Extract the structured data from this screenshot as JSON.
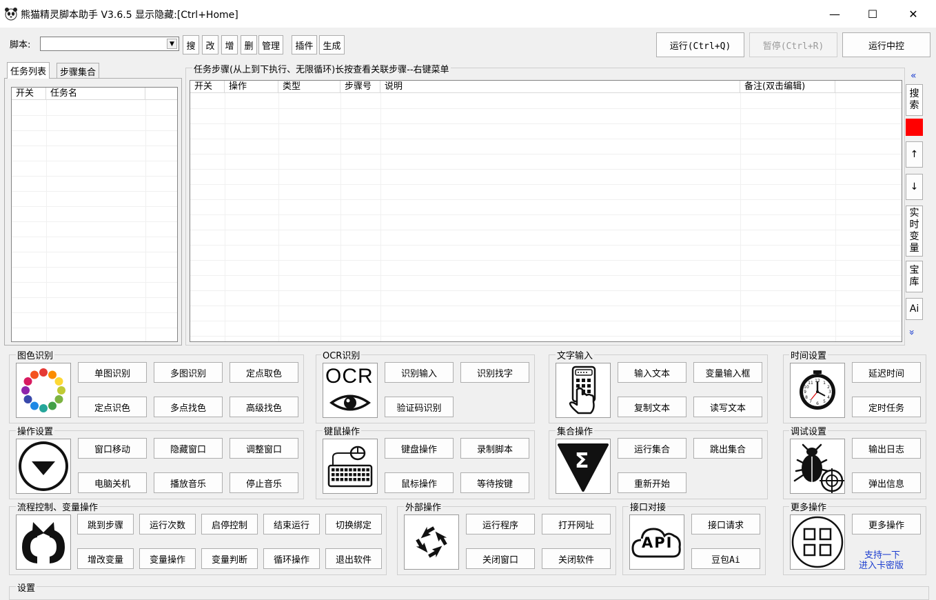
{
  "titlebar": {
    "title": "熊猫精灵脚本助手  V3.6.5  显示隐藏:[Ctrl+Home]",
    "minimize": "—",
    "maximize": "☐",
    "close": "✕"
  },
  "toolbar": {
    "script_label": "脚本:",
    "script_value": "",
    "btn_search": "搜",
    "btn_edit": "改",
    "btn_add": "增",
    "btn_delete": "删",
    "btn_manage": "管理",
    "btn_plugin": "插件",
    "btn_generate": "生成",
    "btn_run": "运行(Ctrl+Q)",
    "btn_pause": "暂停(Ctrl+R)",
    "btn_run_control": "运行中控"
  },
  "left": {
    "tab_tasks": "任务列表",
    "tab_sets": "步骤集合",
    "col_switch": "开关",
    "col_name": "任务名"
  },
  "steps": {
    "title": "任务步骤(从上到下执行、无限循环)长按查看关联步骤--右键菜单",
    "columns": [
      "开关",
      "操作",
      "类型",
      "步骤号",
      "说明",
      "备注(双击编辑)"
    ]
  },
  "side": {
    "collapse": "«",
    "search": "搜\n索",
    "up": "↑",
    "down": "↓",
    "realtime_vars": "实\n时\n变\n量",
    "treasury": "宝\n库",
    "ai": "Ai",
    "expand": "»"
  },
  "groups": {
    "image_color": {
      "title": "图色识别",
      "buttons": [
        "单图识别",
        "多图识别",
        "定点取色",
        "定点识色",
        "多点找色",
        "高级找色"
      ]
    },
    "ocr": {
      "title": "OCR识别",
      "icon_text": "OCR",
      "buttons": [
        "识别输入",
        "识别找字",
        "验证码识别"
      ]
    },
    "text_input": {
      "title": "文字输入",
      "buttons": [
        "输入文本",
        "变量输入框",
        "复制文本",
        "读写文本"
      ]
    },
    "time": {
      "title": "时间设置",
      "buttons": [
        "延迟时间",
        "定时任务"
      ]
    },
    "operation": {
      "title": "操作设置",
      "buttons": [
        "窗口移动",
        "隐藏窗口",
        "调整窗口",
        "电脑关机",
        "播放音乐",
        "停止音乐"
      ]
    },
    "keymouse": {
      "title": "键鼠操作",
      "buttons": [
        "键盘操作",
        "录制脚本",
        "鼠标操作",
        "等待按键"
      ]
    },
    "set_ops": {
      "title": "集合操作",
      "icon_text": "Σ",
      "buttons": [
        "运行集合",
        "跳出集合",
        "重新开始"
      ]
    },
    "debug": {
      "title": "调试设置",
      "buttons": [
        "输出日志",
        "弹出信息"
      ]
    },
    "flow": {
      "title": "流程控制、变量操作",
      "buttons": [
        "跳到步骤",
        "运行次数",
        "启停控制",
        "结束运行",
        "切换绑定",
        "增改变量",
        "变量操作",
        "变量判断",
        "循环操作",
        "退出软件"
      ]
    },
    "external": {
      "title": "外部操作",
      "buttons": [
        "运行程序",
        "打开网址",
        "关闭窗口",
        "关闭软件"
      ]
    },
    "api": {
      "title": "接口对接",
      "icon_text": "API",
      "buttons": [
        "接口请求",
        "豆包Ai"
      ]
    },
    "more": {
      "title": "更多操作",
      "buttons": [
        "更多操作"
      ],
      "support_line1": "支持一下",
      "support_line2": "进入卡密版"
    }
  },
  "settings": {
    "title": "设置"
  },
  "colors": {
    "accent_red": "#ff0000",
    "link_blue": "#1a3ccf"
  }
}
